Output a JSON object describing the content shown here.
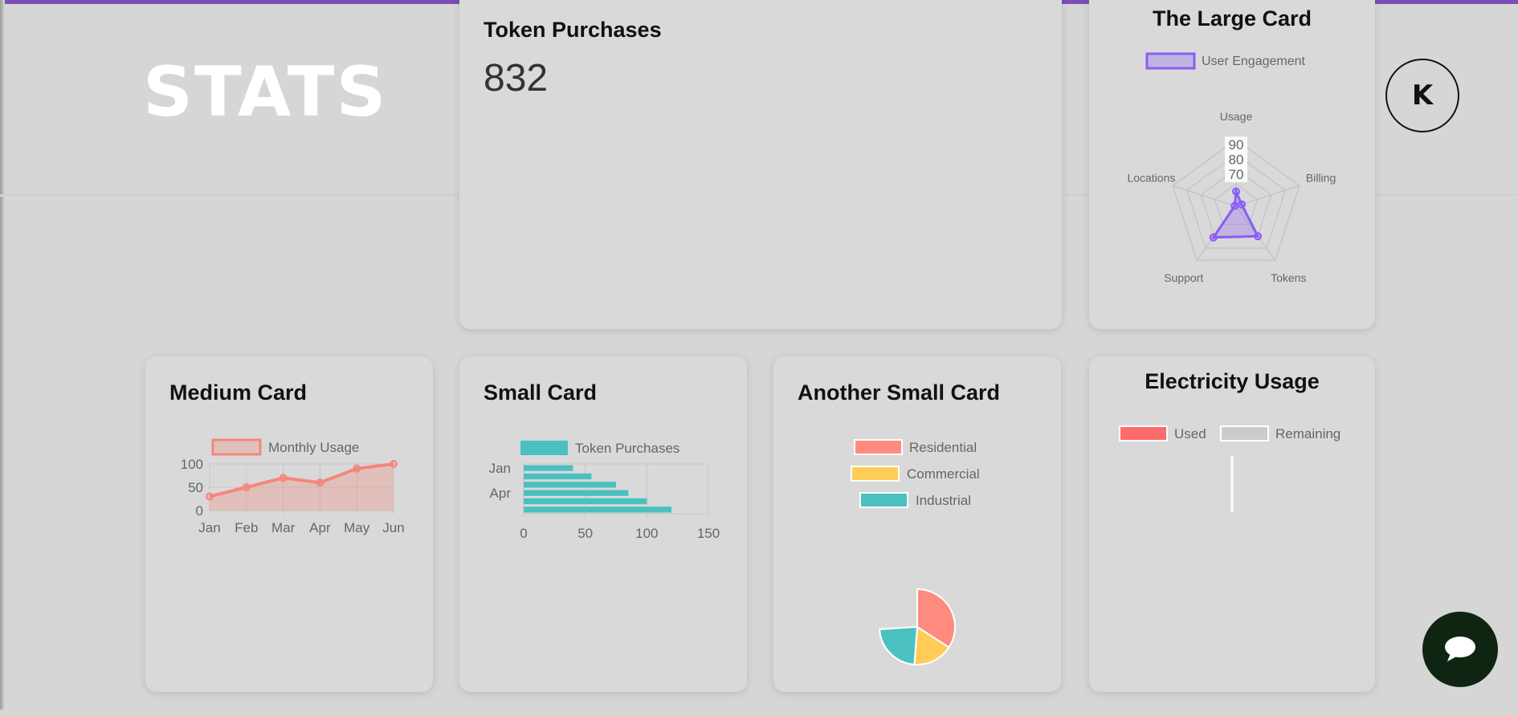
{
  "header": {
    "logo_text": "STATS",
    "avatar_initial": "K"
  },
  "colors": {
    "accent_bar": "#7a4fb5",
    "radar": "#8b5cf6",
    "line": "#f4877b",
    "bar": "#4bc0c0",
    "pie_residential": "#ff8a80",
    "pie_commercial": "#ffcd56",
    "pie_industrial": "#4bc0c0",
    "used": "#ff6b6b",
    "remaining": "#c9cbcf"
  },
  "token_card": {
    "title": "Token Purchases",
    "value": "832"
  },
  "large_card": {
    "title": "The Large Card",
    "chart_data": {
      "type": "radar",
      "legend": [
        "User Engagement"
      ],
      "labels": [
        "Usage",
        "Billing",
        "Tokens",
        "Support",
        "Locations"
      ],
      "tick_labels": [
        "70",
        "80",
        "90"
      ],
      "series": [
        {
          "name": "User Engagement",
          "values": [
            65,
            59,
            80,
            81,
            56
          ]
        }
      ]
    }
  },
  "medium_card": {
    "title": "Medium Card",
    "chart_data": {
      "type": "line",
      "legend": [
        "Monthly Usage"
      ],
      "categories": [
        "Jan",
        "Feb",
        "Mar",
        "Apr",
        "May",
        "Jun"
      ],
      "y_ticks": [
        "100",
        "50",
        "0"
      ],
      "ylim": [
        0,
        100
      ],
      "series": [
        {
          "name": "Monthly Usage",
          "values": [
            30,
            50,
            70,
            60,
            90,
            100
          ]
        }
      ]
    }
  },
  "small_card": {
    "title": "Small Card",
    "chart_data": {
      "type": "bar",
      "orientation": "horizontal",
      "legend": [
        "Token Purchases"
      ],
      "y_tick_labels": [
        "Jan",
        "Apr"
      ],
      "x_ticks": [
        "0",
        "50",
        "100",
        "150"
      ],
      "xlim": [
        0,
        150
      ],
      "series": [
        {
          "name": "Token Purchases",
          "values": [
            40,
            55,
            75,
            85,
            100,
            120
          ]
        }
      ]
    }
  },
  "another_small_card": {
    "title": "Another Small Card",
    "chart_data": {
      "type": "pie",
      "legend": [
        "Residential",
        "Commercial",
        "Industrial"
      ],
      "values": [
        30,
        15,
        20
      ]
    }
  },
  "electricity_card": {
    "title": "Electricity Usage",
    "chart_data": {
      "type": "doughnut",
      "legend": [
        "Used",
        "Remaining"
      ]
    }
  }
}
